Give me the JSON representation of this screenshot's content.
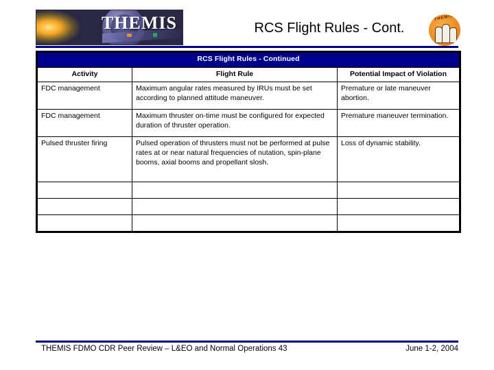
{
  "header": {
    "logo_word": "THEMIS",
    "badge_text": "THEMIS",
    "title": "RCS Flight Rules - Cont."
  },
  "table": {
    "caption": "RCS Flight Rules - Continued",
    "columns": [
      "Activity",
      "Flight Rule",
      "Potential Impact of Violation"
    ],
    "rows": [
      {
        "activity": "FDC management",
        "rule": "Maximum angular rates measured by IRUs must be set according to planned attitude maneuver.",
        "impact": "Premature or late maneuver abortion."
      },
      {
        "activity": "FDC management",
        "rule": "Maximum thruster on-time must be configured for expected duration of thruster operation.",
        "impact": "Premature maneuver termination."
      },
      {
        "activity": "Pulsed thruster firing",
        "rule": "Pulsed operation of thrusters must not be performed at pulse rates at or near natural frequencies of nutation, spin-plane booms, axial booms and propellant slosh.",
        "impact": "Loss of dynamic stability."
      },
      {
        "activity": "",
        "rule": "",
        "impact": ""
      },
      {
        "activity": "",
        "rule": "",
        "impact": ""
      },
      {
        "activity": "",
        "rule": "",
        "impact": ""
      }
    ]
  },
  "footer": {
    "left": "THEMIS FDMO CDR Peer Review – L&EO and Normal Operations 43",
    "right": "June 1-2, 2004"
  },
  "colors": {
    "header_blue": "#00008B",
    "rule_navy": "#000080",
    "badge_orange": "#f08c22"
  }
}
